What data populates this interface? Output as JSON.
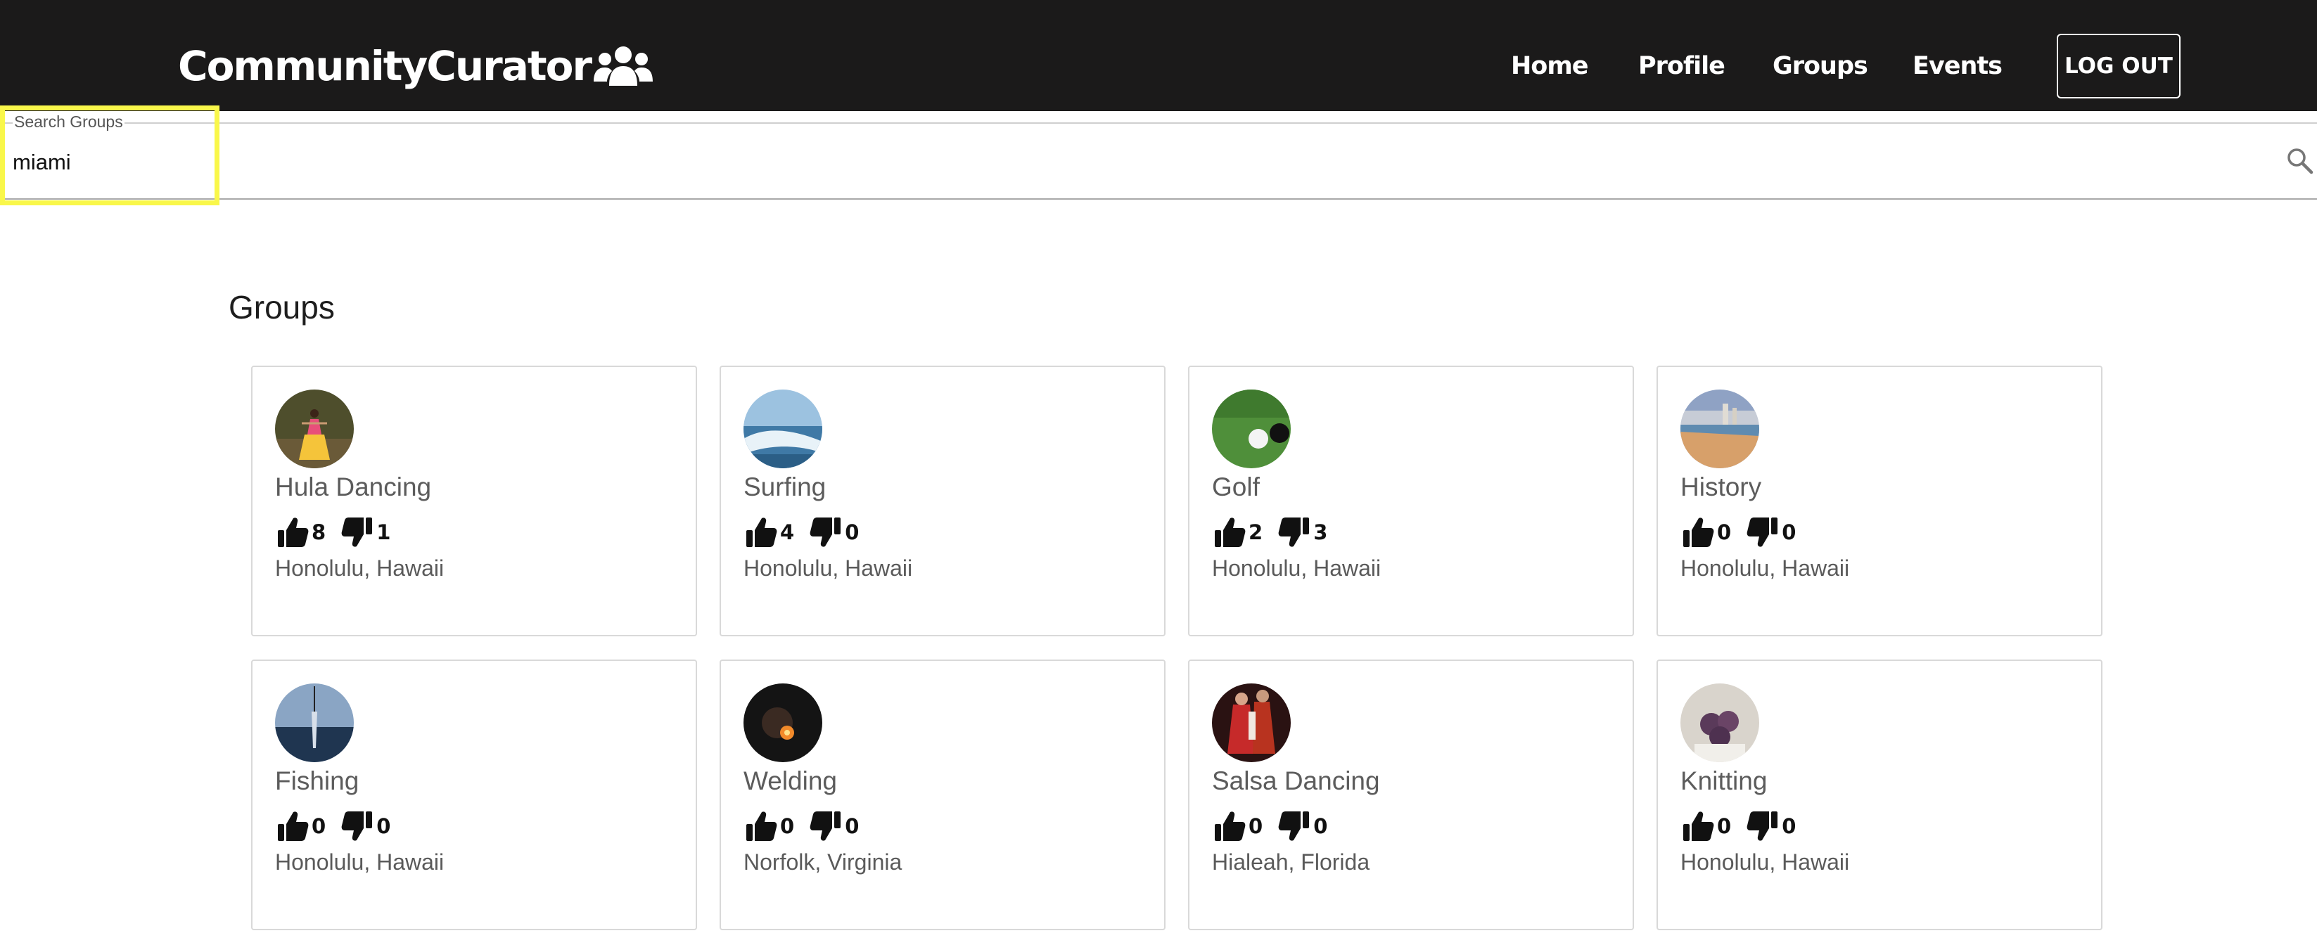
{
  "header": {
    "brand": "CommunityCurator",
    "nav": [
      "Home",
      "Profile",
      "Groups",
      "Events"
    ],
    "logout_label": "LOG OUT"
  },
  "search": {
    "label": "Search Groups",
    "value": "miami"
  },
  "main": {
    "section_title": "Groups",
    "groups": [
      {
        "name": "Hula Dancing",
        "likes": "8",
        "dislikes": "1",
        "location": "Honolulu, Hawaii",
        "thumb": "hula-dancer-photo"
      },
      {
        "name": "Surfing",
        "likes": "4",
        "dislikes": "0",
        "location": "Honolulu, Hawaii",
        "thumb": "wave-photo"
      },
      {
        "name": "Golf",
        "likes": "2",
        "dislikes": "3",
        "location": "Honolulu, Hawaii",
        "thumb": "golf-ball-photo"
      },
      {
        "name": "History",
        "likes": "0",
        "dislikes": "0",
        "location": "Honolulu, Hawaii",
        "thumb": "beach-city-photo"
      },
      {
        "name": "Fishing",
        "likes": "0",
        "dislikes": "0",
        "location": "Honolulu, Hawaii",
        "thumb": "fishing-photo"
      },
      {
        "name": "Welding",
        "likes": "0",
        "dislikes": "0",
        "location": "Norfolk, Virginia",
        "thumb": "welding-photo"
      },
      {
        "name": "Salsa Dancing",
        "likes": "0",
        "dislikes": "0",
        "location": "Hialeah, Florida",
        "thumb": "salsa-photo"
      },
      {
        "name": "Knitting",
        "likes": "0",
        "dislikes": "0",
        "location": "Honolulu, Hawaii",
        "thumb": "yarn-photo"
      }
    ]
  },
  "colors": {
    "header_bg": "#1b1a1a",
    "highlight": "#f9f74a",
    "card_border": "#d9d9d9"
  },
  "icons": [
    "people-group-icon",
    "search-icon",
    "thumbs-up-icon",
    "thumbs-down-icon"
  ]
}
